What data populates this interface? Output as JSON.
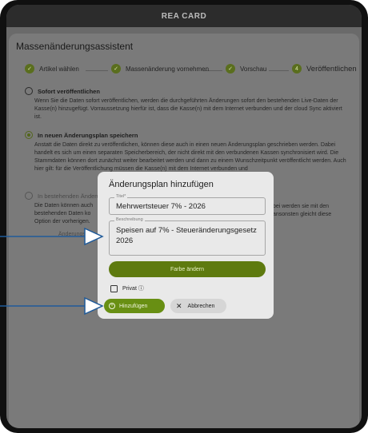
{
  "app": {
    "title": "REA CARD"
  },
  "assistant": {
    "title": "Massenänderungsassistent"
  },
  "steps": [
    {
      "label": "Artikel wählen",
      "icon": "check-icon"
    },
    {
      "label": "Massenänderung vornehmen",
      "icon": "check-icon"
    },
    {
      "label": "Vorschau",
      "icon": "check-icon"
    },
    {
      "label": "Veröffentlichen",
      "number": "4"
    }
  ],
  "options": [
    {
      "title": "Sofort veröffentlichen",
      "desc": "Wenn Sie die Daten sofort veröffentlichen, werden die durchgeführten Änderungen sofort den bestehenden Live-Daten der Kasse(n) hinzugefügt. Vorraussetzung hierfür ist, dass die Kasse(n) mit dem Internet verbunden und der cloud Sync aktiviert ist.",
      "selected": false
    },
    {
      "title": "In neuen Änderungsplan speichern",
      "desc": "Anstatt die Daten direkt zu veröffentlichen, können diese auch in einen neuen Änderungsplan geschrieben werden. Dabei handelt es sich um einen separaten Speicherbereich, der nicht direkt mit den verbundenen Kassen synchronisiert wird. Die Stammdaten können dort zunächst weiter bearbeitet werden und dann zu einem Wunschzeitpunkt veröffentlicht werden. Auch hier gilt: für die Veröffentlichung müssen die Kasse(n) mit dem Internet verbunden und",
      "selected": true
    },
    {
      "title": "In bestehenden Änderu",
      "desc_left": "Die Daten können auch\nbestehenden Daten ko\nOption der vorherigen.",
      "desc_right": "bei werden sie mit den\nansonsten gleicht diese",
      "extra": "Änderungspl",
      "selected": false
    }
  ],
  "dialog": {
    "title": "Änderungsplan hinzufügen",
    "title_field": {
      "label": "Titel*",
      "value": "Mehrwertsteuer 7% - 2026"
    },
    "desc_field": {
      "label": "Beschreibung",
      "value": "Speisen auf 7% - Steueränderungsgesetz 2026"
    },
    "color_button": "Farbe ändern",
    "private_label": "Privat ⓘ",
    "private_checked": false,
    "add_button": "Hinzufügen",
    "cancel_button": "Abbrechen"
  },
  "colors": {
    "accent": "#688f13",
    "accent_dark": "#5e7a0f",
    "annotation": "#1f5a99"
  }
}
